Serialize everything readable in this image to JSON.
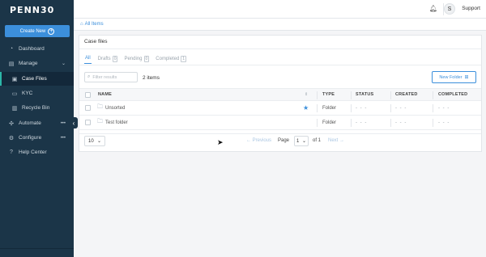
{
  "app": {
    "logo_text": "PENN30"
  },
  "sidebar": {
    "create_label": "Create New",
    "items": [
      {
        "label": "Dashboard",
        "icon": "dashboard-icon"
      },
      {
        "label": "Manage",
        "icon": "manage-icon"
      },
      {
        "label": "Case Files",
        "icon": "case-files-icon"
      },
      {
        "label": "KYC",
        "icon": "kyc-icon"
      },
      {
        "label": "Recycle Bin",
        "icon": "trash-icon"
      },
      {
        "label": "Automate",
        "icon": "automate-icon"
      },
      {
        "label": "Configure",
        "icon": "configure-icon"
      },
      {
        "label": "Help Center",
        "icon": "help-icon"
      }
    ],
    "more_glyph": "•••"
  },
  "topbar": {
    "avatar_initial": "S",
    "support_label": "Support"
  },
  "breadcrumb": {
    "label": "All Items"
  },
  "panel": {
    "title": "Case files",
    "tabs": [
      {
        "label": "All",
        "count": ""
      },
      {
        "label": "Drafts",
        "count": "0"
      },
      {
        "label": "Pending",
        "count": "0"
      },
      {
        "label": "Completed",
        "count": "1"
      }
    ],
    "search_placeholder": "Filter results",
    "items_count": "2 items",
    "new_folder_label": "New Folder"
  },
  "table": {
    "headers": {
      "name": "NAME",
      "type": "TYPE",
      "status": "STATUS",
      "created": "CREATED",
      "completed": "COMPLETED"
    },
    "rows": [
      {
        "name": "Unsorted",
        "type": "Folder",
        "status": "- - -",
        "created": "- - -",
        "completed": "- - -",
        "starred": true
      },
      {
        "name": "Test folder",
        "type": "Folder",
        "status": "- - -",
        "created": "- - -",
        "completed": "- - -",
        "starred": false
      }
    ]
  },
  "pagination": {
    "page_size": "10",
    "prev_label": "Previous",
    "page_label": "Page",
    "current_page": "1",
    "of_label": "of 1",
    "next_label": "Next"
  },
  "colors": {
    "sidebar": "#1b3548",
    "accent": "#3c8fdb",
    "active_marker": "#2cb6a8"
  }
}
